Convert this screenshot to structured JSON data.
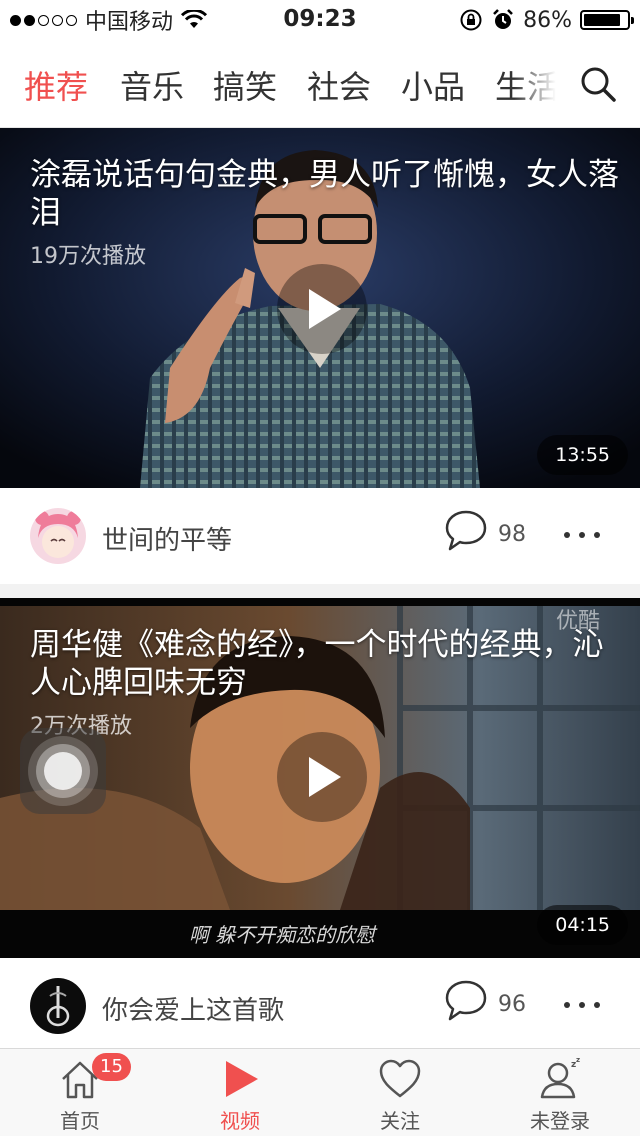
{
  "status_bar": {
    "carrier": "中国移动",
    "time": "09:23",
    "battery_percent": "86%",
    "signal_strength": 2,
    "signal_total": 5
  },
  "category_tabs": [
    {
      "label": "推荐",
      "active": true
    },
    {
      "label": "音乐",
      "active": false
    },
    {
      "label": "搞笑",
      "active": false
    },
    {
      "label": "社会",
      "active": false
    },
    {
      "label": "小品",
      "active": false
    },
    {
      "label": "生活",
      "active": false
    }
  ],
  "videos": [
    {
      "title": "涂磊说话句句金典，男人听了惭愧，女人落泪",
      "play_count": "19万次播放",
      "duration": "13:55",
      "author": "世间的平等",
      "comments": "98"
    },
    {
      "title": "周华健《难念的经》，一个时代的经典，沁人心脾回味无穷",
      "play_count": "2万次播放",
      "duration": "04:15",
      "author": "你会爱上这首歌",
      "comments": "96",
      "watermark": "优酷",
      "subtitle": "啊 躲不开痴恋的欣慰"
    }
  ],
  "bottom_tabs": [
    {
      "label": "首页",
      "icon": "home-icon",
      "badge": "15",
      "active": false
    },
    {
      "label": "视频",
      "icon": "play-icon",
      "active": true
    },
    {
      "label": "关注",
      "icon": "heart-icon",
      "active": false
    },
    {
      "label": "未登录",
      "icon": "user-sleep-icon",
      "active": false
    }
  ],
  "colors": {
    "accent": "#f0504f",
    "text": "#333333",
    "background": "#f2f2f2"
  }
}
